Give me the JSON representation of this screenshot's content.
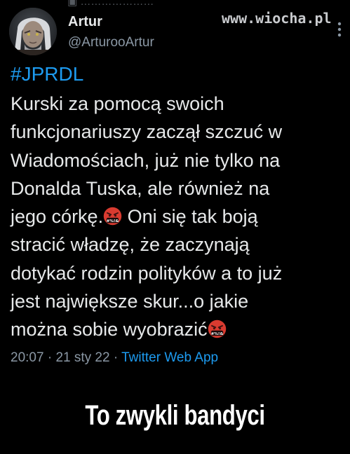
{
  "top_fade_text": "▣ …………………",
  "author": {
    "name": "Artur",
    "handle": "@ArturooArtur"
  },
  "watermark": "www.wiocha.pl",
  "tweet": {
    "hashtag": "#JPRDL",
    "lines": [
      "Kurski za pomocą swoich",
      "funkcjonariuszy zaczął szczuć w",
      "Wiadomościach, już nie tylko na",
      "Donalda Tuska, ale również na"
    ],
    "line5_before": "jego córkę.",
    "line5_after": "  Oni się tak boją",
    "lines_b": [
      "stracić władzę, że zaczynają",
      "dotykać rodzin polityków a to już",
      "jest największe skur...o jakie"
    ],
    "line9_before": "można sobie wyobrazić",
    "emoji_name": "face-with-symbols-on-mouth",
    "emoji_symbols": "#%!&"
  },
  "meta": {
    "time": "20:07",
    "separator1": " · ",
    "date": "21 sty 22",
    "separator2": " · ",
    "source": "Twitter Web App"
  },
  "caption": "To zwykli bandyci",
  "colors": {
    "background": "#000000",
    "text": "#e7e9ea",
    "secondary": "#8b98a5",
    "link": "#1d9bf0",
    "caption": "#ffffff",
    "emoji_face": "#d93b30"
  }
}
